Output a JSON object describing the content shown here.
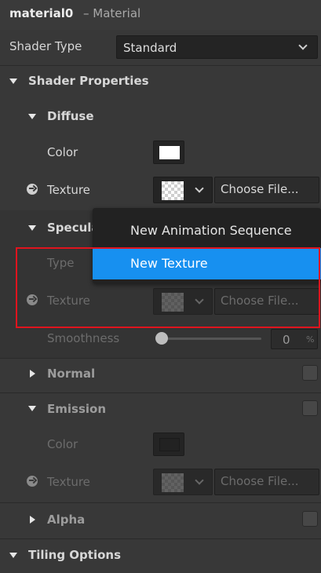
{
  "window": {
    "title_main": "material0",
    "title_sub": "– Material"
  },
  "shader_type": {
    "label": "Shader Type",
    "value": "Standard"
  },
  "sections": {
    "shader_properties": "Shader Properties",
    "diffuse": "Diffuse",
    "specular": "Specula",
    "normal": "Normal",
    "emission": "Emission",
    "alpha": "Alpha",
    "tiling_options": "Tiling Options"
  },
  "diffuse": {
    "color_label": "Color",
    "color_value": "#ffffff",
    "texture_label": "Texture",
    "choose_file": "Choose File..."
  },
  "specular": {
    "type_label": "Type",
    "texture_label": "Texture",
    "choose_file": "Choose File...",
    "smoothness_label": "Smoothness",
    "smoothness_value": "0",
    "smoothness_unit": "%"
  },
  "emission": {
    "color_label": "Color",
    "color_value": "#222222",
    "texture_label": "Texture",
    "choose_file": "Choose File..."
  },
  "context_menu": {
    "items": [
      "New Animation Sequence",
      "New Texture"
    ],
    "active_index": 1
  },
  "colors": {
    "accent": "#1790f0",
    "highlight_border": "#e0141e",
    "panel_bg": "#383838"
  }
}
